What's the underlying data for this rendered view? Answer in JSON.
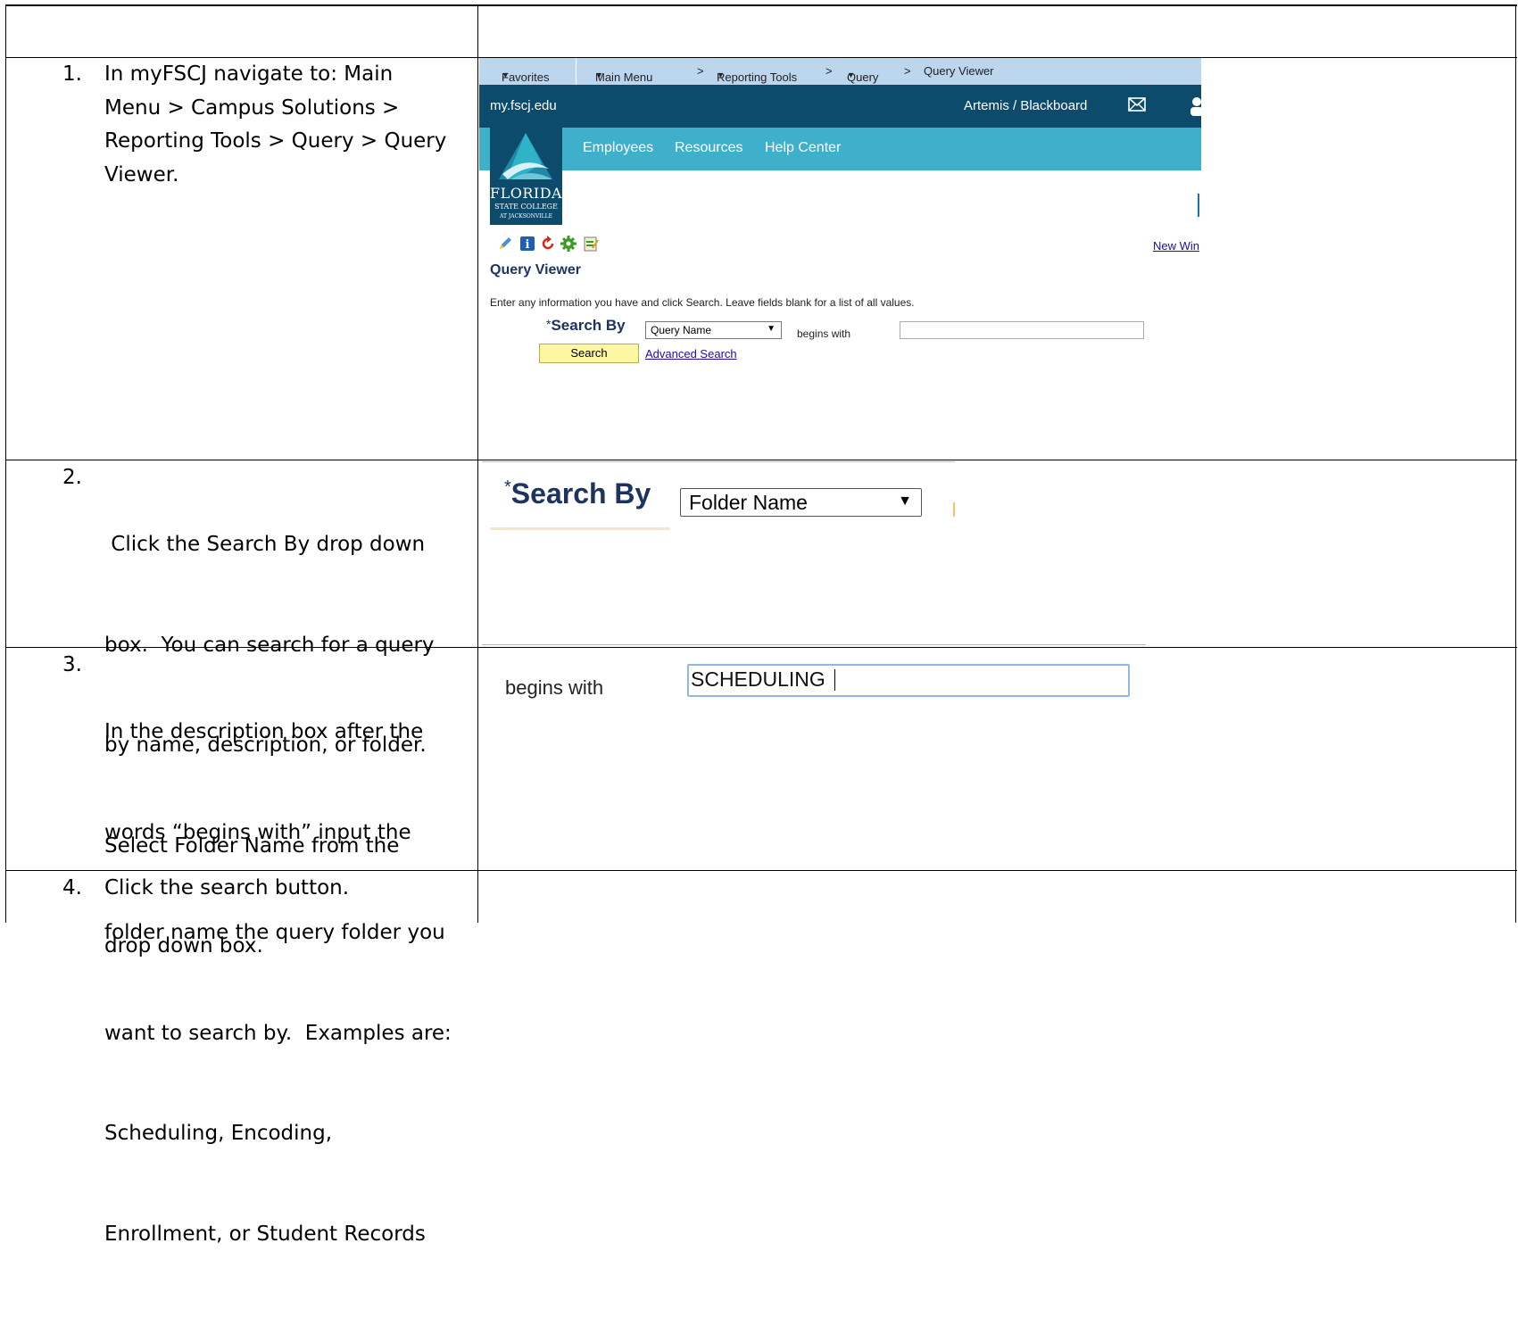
{
  "steps": [
    {
      "number": "1.",
      "lines": [
        "In myFSCJ navigate to: Main",
        "Menu > Campus Solutions >",
        "Reporting Tools > Query > Query",
        "Viewer."
      ]
    },
    {
      "number": "2.",
      "lines": [
        " Click the Search By drop down",
        "box.  You can search for a query",
        "by name, description, or folder.",
        "Select Folder Name from the",
        "drop down box."
      ]
    },
    {
      "number": "3.",
      "lines": [
        "In the description box after the",
        "words “begins with” input the",
        "folder name the query folder you",
        "want to search by.  Examples are:",
        "Scheduling, Encoding,",
        "Enrollment, or Student Records"
      ]
    },
    {
      "number": "4.",
      "lines": [
        "Click the search button."
      ]
    }
  ],
  "screenshot1": {
    "nav": {
      "favorites": "Favorites",
      "main_menu": "Main Menu",
      "reporting_tools": "Reporting Tools",
      "query": "Query",
      "query_viewer": "Query Viewer",
      "sep": ">"
    },
    "header": {
      "site": "my.fscj.edu",
      "artemis": "Artemis / Blackboard"
    },
    "menu": {
      "employees": "Employees",
      "resources": "Resources",
      "help_center": "Help Center"
    },
    "logo": {
      "line1": "FLORIDA",
      "line2": "STATE COLLEGE",
      "line3": "AT JACKSONVILLE"
    },
    "new_window": "New Win",
    "title": "Query Viewer",
    "instructions": "Enter any information you have and click Search. Leave fields blank for a list of all values.",
    "search_by_label": "Search By",
    "required_mark": "*",
    "search_by_value": "Query Name",
    "begins_with": "begins with",
    "search_button": "Search",
    "advanced_search": "Advanced Search",
    "colors": {
      "nav_bg": "#bcd6ee",
      "header_bg": "#0d4b6d",
      "menu_bg": "#3fb0cc",
      "search_btn_bg": "#fbf7a2"
    }
  },
  "screenshot2": {
    "required_mark": "*",
    "search_by_label": "Search By",
    "search_by_value": "Folder Name"
  },
  "screenshot3": {
    "begins_with": "begins with",
    "input_value": "SCHEDULING"
  }
}
